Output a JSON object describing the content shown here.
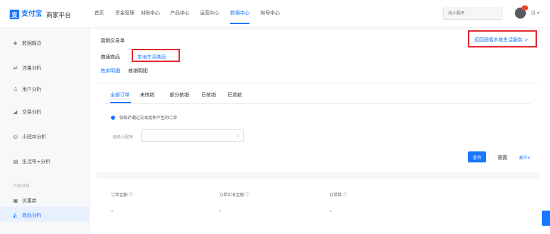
{
  "brand": {
    "logo_mark": "支",
    "name": "支付宝",
    "platform": "商家平台"
  },
  "top_nav": [
    {
      "label": "首页"
    },
    {
      "label": "资金管理"
    },
    {
      "label": "对账中心"
    },
    {
      "label": "产品中心"
    },
    {
      "label": "运营中心"
    },
    {
      "label": "数据中心"
    },
    {
      "label": "账号中心"
    }
  ],
  "top_nav_active": 5,
  "search": {
    "placeholder": "找小程序"
  },
  "user_menu": "设 ▾",
  "sidebar": {
    "items": [
      {
        "icon": "chart-icon",
        "glyph": "◈",
        "label": "数据概览"
      },
      {
        "icon": "traffic-icon",
        "glyph": "⇄",
        "label": "流量分析"
      },
      {
        "icon": "users-icon",
        "glyph": "♙",
        "label": "用户分析"
      },
      {
        "icon": "trade-icon",
        "glyph": "◢",
        "label": "交易分析"
      },
      {
        "icon": "miniapp-icon",
        "glyph": "◎",
        "label": "小程序分析"
      },
      {
        "icon": "life-icon",
        "glyph": "▤",
        "label": "生活号+分析"
      }
    ],
    "group_label": "产品分析",
    "group_items": [
      {
        "icon": "coupon-icon",
        "glyph": "▣",
        "label": "优惠券"
      },
      {
        "icon": "goods-icon",
        "glyph": "◭",
        "label": "商品分析"
      }
    ]
  },
  "page": {
    "title": "营销交易单",
    "sub_tabs": [
      "普通商品",
      "本地生活商品"
    ],
    "sub_links": [
      "售卖明细",
      "核销明细"
    ],
    "back_link": "返回旧版本地生活服务 >"
  },
  "orders": {
    "tabs": [
      "全部订单",
      "未核销",
      "部分核销",
      "已核销",
      "已退款"
    ],
    "notice": "仅统计通过交易组件产生的订单",
    "filter_label": "选择小程序",
    "query": "查询",
    "reset": "重置",
    "expand": "展开∨"
  },
  "stats": [
    {
      "label": "订单金额 ⓘ",
      "value": "-"
    },
    {
      "label": "订单实收金额 ⓘ",
      "value": "-"
    },
    {
      "label": "订单数 ⓘ",
      "value": "-"
    }
  ],
  "colors": {
    "accent": "#1677ff",
    "highlight": "#e5262d",
    "badge": "#f04134"
  }
}
